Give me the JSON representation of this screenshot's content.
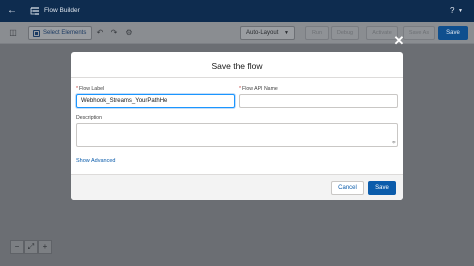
{
  "header": {
    "back_icon": "back-arrow-icon",
    "app_title": "Flow Builder",
    "help_label": "?",
    "colors": {
      "bar": "#0e2c4f"
    }
  },
  "toolbar": {
    "select_elements_label": "Select Elements",
    "auto_layout_label": "Auto-Layout",
    "buttons": {
      "run": "Run",
      "debug": "Debug",
      "activate": "Activate",
      "save_as": "Save As",
      "save": "Save"
    },
    "accent": "#0f4f8e"
  },
  "canvas": {
    "zoom_out": "−",
    "fit": "⤢",
    "zoom_in": "+"
  },
  "modal": {
    "title": "Save the flow",
    "fields": {
      "flow_label": {
        "label": "Flow Label",
        "required": "*",
        "value": "Webhook_Streams_YourPathHe"
      },
      "flow_api_name": {
        "label": "Flow API Name",
        "required": "*",
        "value": ""
      },
      "description": {
        "label": "Description",
        "value": ""
      }
    },
    "show_advanced": "Show Advanced",
    "cancel_label": "Cancel",
    "save_label": "Save",
    "primary_color": "#0b5cab"
  }
}
